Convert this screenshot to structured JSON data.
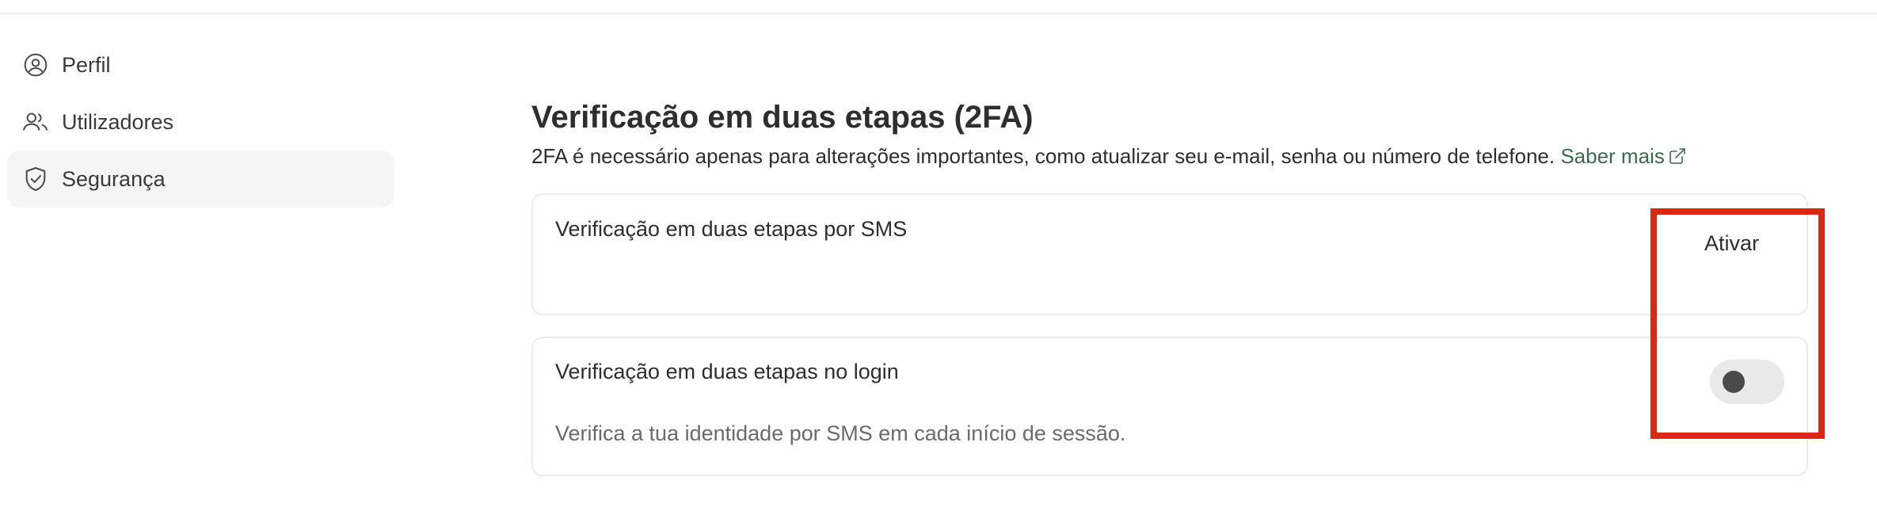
{
  "sidebar": {
    "items": [
      {
        "label": "Perfil",
        "icon": "user-circle-icon"
      },
      {
        "label": "Utilizadores",
        "icon": "users-icon"
      },
      {
        "label": "Segurança",
        "icon": "shield-check-icon",
        "active": true
      }
    ]
  },
  "main": {
    "title": "Verificação em duas etapas (2FA)",
    "description": "2FA é necessário apenas para alterações importantes, como atualizar seu e-mail, senha ou número de telefone.",
    "learn_more": "Saber mais",
    "sms_card": {
      "title": "Verificação em duas etapas por SMS",
      "action_label": "Ativar"
    },
    "login_card": {
      "title": "Verificação em duas etapas no login",
      "subtitle": "Verifica a tua identidade por SMS em cada início de sessão.",
      "toggle_on": false
    }
  },
  "colors": {
    "accent_link": "#3a6b4f",
    "highlight": "#d92a11",
    "active_bg": "#f5f5f5"
  }
}
